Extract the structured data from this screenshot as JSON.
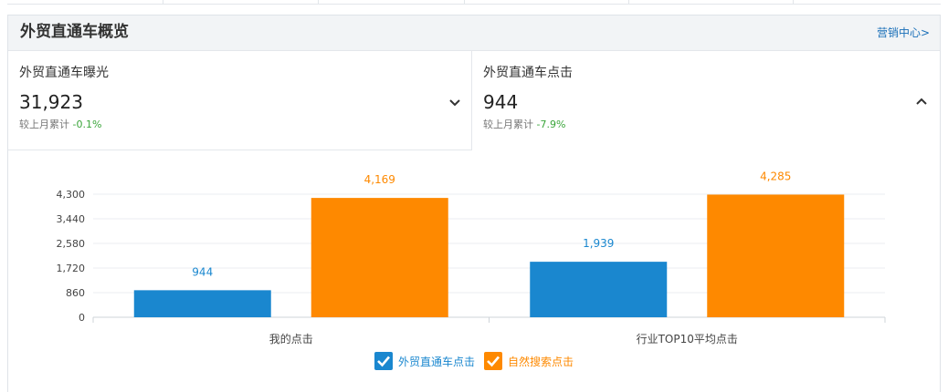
{
  "header": {
    "title": "外贸直通车概览",
    "link_label": "营销中心>"
  },
  "cards": [
    {
      "label": "外贸直通车曝光",
      "value": "31,923",
      "compare_label": "较上月累计",
      "compare_delta": "-0.1%",
      "toggle_icon": "chevron-down-icon"
    },
    {
      "label": "外贸直通车点击",
      "value": "944",
      "compare_label": "较上月累计",
      "compare_delta": "-7.9%",
      "toggle_icon": "chevron-up-icon"
    }
  ],
  "colors": {
    "series_blue": "#1a87cf",
    "series_orange": "#fe8900",
    "delta_green": "#3aa53a",
    "link_blue": "#1a6fb8"
  },
  "chart_data": {
    "type": "bar",
    "categories": [
      "我的点击",
      "行业TOP10平均点击"
    ],
    "series": [
      {
        "name": "外贸直通车点击",
        "values": [
          944,
          1939
        ],
        "labels": [
          "944",
          "1,939"
        ],
        "color": "#1a87cf"
      },
      {
        "name": "自然搜索点击",
        "values": [
          4169,
          4285
        ],
        "labels": [
          "4,169",
          "4,285"
        ],
        "color": "#fe8900"
      }
    ],
    "y_ticks": [
      "0",
      "860",
      "1,720",
      "2,580",
      "3,440",
      "4,300"
    ],
    "y_tick_values": [
      0,
      860,
      1720,
      2580,
      3440,
      4300
    ],
    "ylim": [
      0,
      4300
    ],
    "grid": true,
    "legend_position": "bottom-center"
  }
}
